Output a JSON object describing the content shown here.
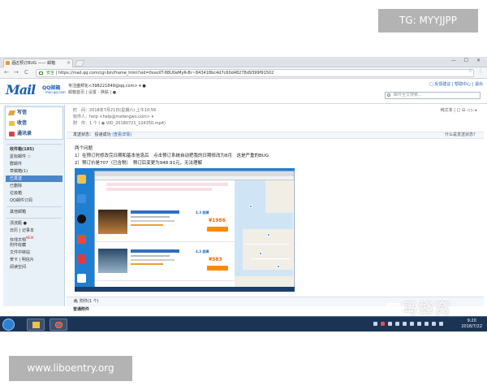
{
  "overlays": {
    "tg_label": "TG: MYYJJPP",
    "site_label": "www.liboentry.org",
    "watermark_text": "马蜂窝"
  },
  "browser": {
    "tab_title": "酒店预订BUG —— 邮箱",
    "tab_close": "×",
    "window_controls": "— ☐ ✕",
    "nav_back": "←",
    "nav_forward": "→",
    "nav_reload": "C",
    "secure_label": "安全",
    "url": "https://mail.qq.com/cgi-bin/frame_html?sid=0ssoXT-88U0eMyR-Br~843418bc4d7c60d48278d9399f91502",
    "star_icon": "☆",
    "menu_icon": "⋮"
  },
  "mail_header": {
    "logo_text": "Mail",
    "logo_sub": "QQ邮箱",
    "logo_domain": "mail.qq.com",
    "user_address": "专注盛邦化<398221849@qq.com> ▾ ●",
    "user_links": "邮箱首页 | 设置 - 换肤 | ●",
    "top_links": "□ 反馈建议 | 帮助中心 | 退出",
    "search_placeholder": "邮件全文搜索..."
  },
  "sidebar": {
    "write_label": "写信",
    "inbox_label": "收信",
    "contacts_label": "通讯录",
    "items": [
      {
        "label": "收件箱(185)"
      },
      {
        "label": "星标邮件 ☆"
      },
      {
        "label": "群邮件"
      },
      {
        "label": "草稿箱(1)"
      },
      {
        "label": "已发送"
      },
      {
        "label": "已删除"
      },
      {
        "label": "垃圾箱"
      },
      {
        "label": "QQ邮件订阅"
      },
      {
        "label": "其他邮箱"
      },
      {
        "label": "漂流瓶 ●"
      },
      {
        "label": "日历 | 记事本"
      },
      {
        "label": "在线文档"
      },
      {
        "label": "附件收藏"
      },
      {
        "label": "文件中转站"
      },
      {
        "label": "贺卡 | 明信片"
      },
      {
        "label": "阅读空间"
      }
    ],
    "new_tag": "NEW"
  },
  "message": {
    "time_line": "时　间：2018年7月21日(星期六) 上午10:56",
    "sender_line": "收件人：help <help@mafengwo.com> ▾",
    "attachment_line": "附　件：1 个 ( ◉ VID_20180721_104350.mp4)",
    "right_actions": "纯文本 | □ ⊟ ◁ ▷ ▸",
    "notice": "发送状态：",
    "notice_status": "投递成功",
    "notice_detail": "(查看详情)",
    "notice_right": "什么是发送状态？",
    "body_lines": [
      "两个问题",
      "1）在预订时修改完日期和基本信息后　点击预订系统自动把我的日期修改为8月　这是严重的BUG",
      "2）预订价是707（已含税）　预订后变更为948.91元，无法理解"
    ],
    "attach_header": "附件(1 个)",
    "attach_ordinary": "普通附件"
  },
  "screenshot": {
    "card_scores": [
      "4.3 超棒",
      "4.3 超棒"
    ],
    "card_prices": [
      "¥1986",
      "¥583"
    ]
  },
  "taskbar": {
    "time": "9:20",
    "date": "2018/7/22"
  }
}
